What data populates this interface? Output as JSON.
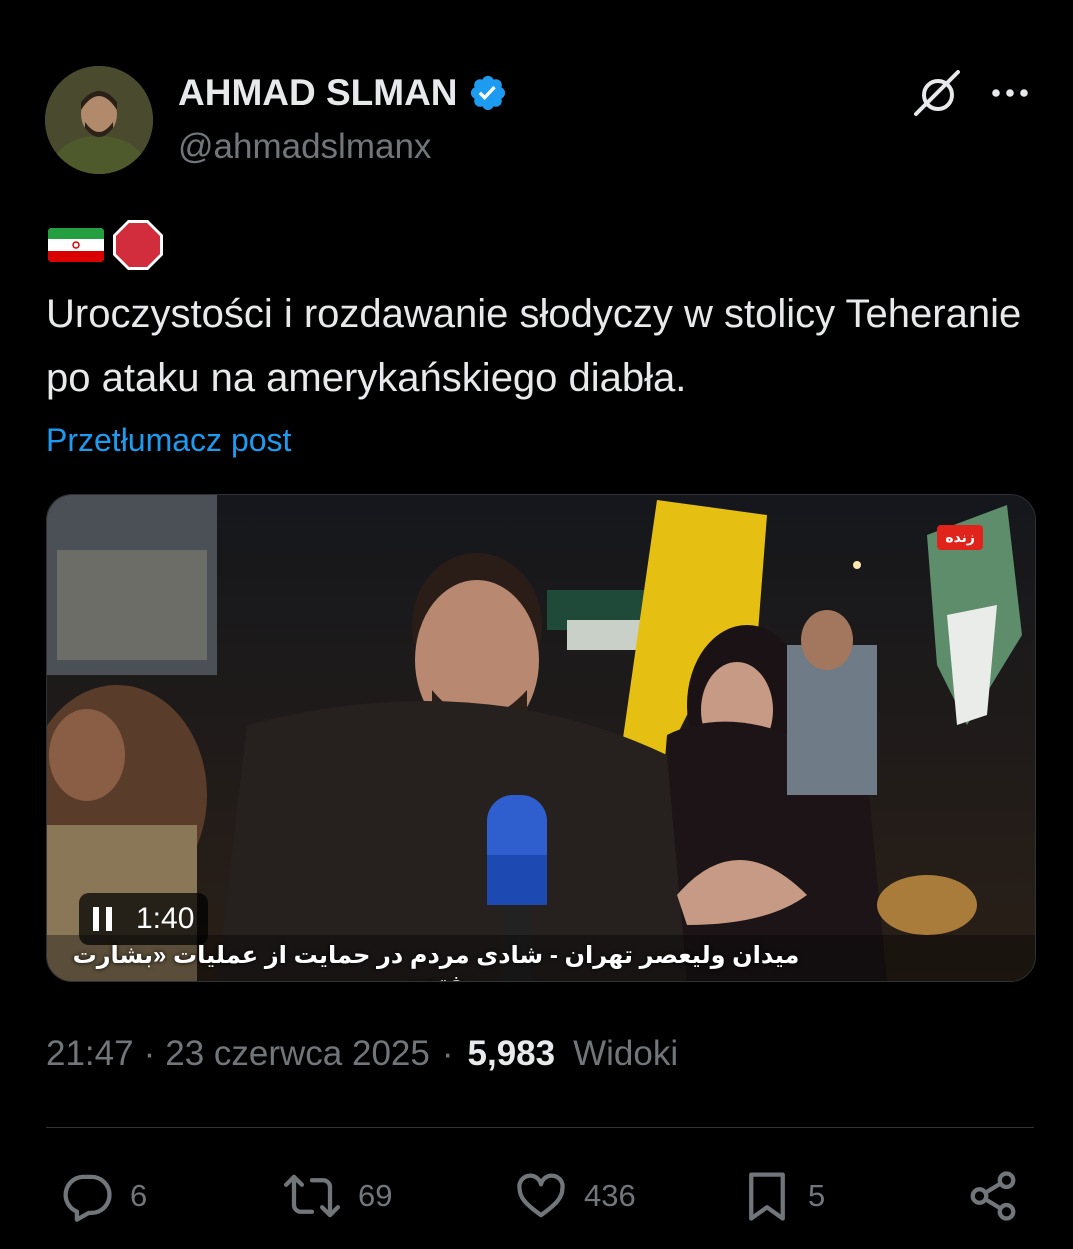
{
  "author": {
    "display_name": "AHMAD SLMAN",
    "handle": "@ahmadslmanx",
    "verified": true,
    "verified_color": "#1d9bf0"
  },
  "header_icons": {
    "grok": "grok-icon",
    "more": "more-icon"
  },
  "tweet": {
    "emojis": [
      "flag-iran",
      "stop-sign"
    ],
    "text": "Uroczystości i rozdawanie słodyczy w stolicy Teheranie po ataku na amerykańskiego diabła.",
    "translate_label": "Przetłumacz post"
  },
  "media": {
    "duration": "1:40",
    "state": "playing",
    "caption": "میدان ولیعصر تهران - شادی مردم در حمایت از عملیات «بشارت فتح»",
    "live_tag": "زنده"
  },
  "meta": {
    "time": "21:47",
    "separator": "·",
    "date": "23 czerwca 2025",
    "views_count": "5,983",
    "views_label": "Widoki"
  },
  "actions": {
    "replies": "6",
    "reposts": "69",
    "likes": "436",
    "bookmarks": "5"
  },
  "colors": {
    "background": "#000000",
    "text": "#e7e9ea",
    "secondary": "#71767b",
    "accent": "#1d9bf0",
    "divider": "#2f3336"
  }
}
